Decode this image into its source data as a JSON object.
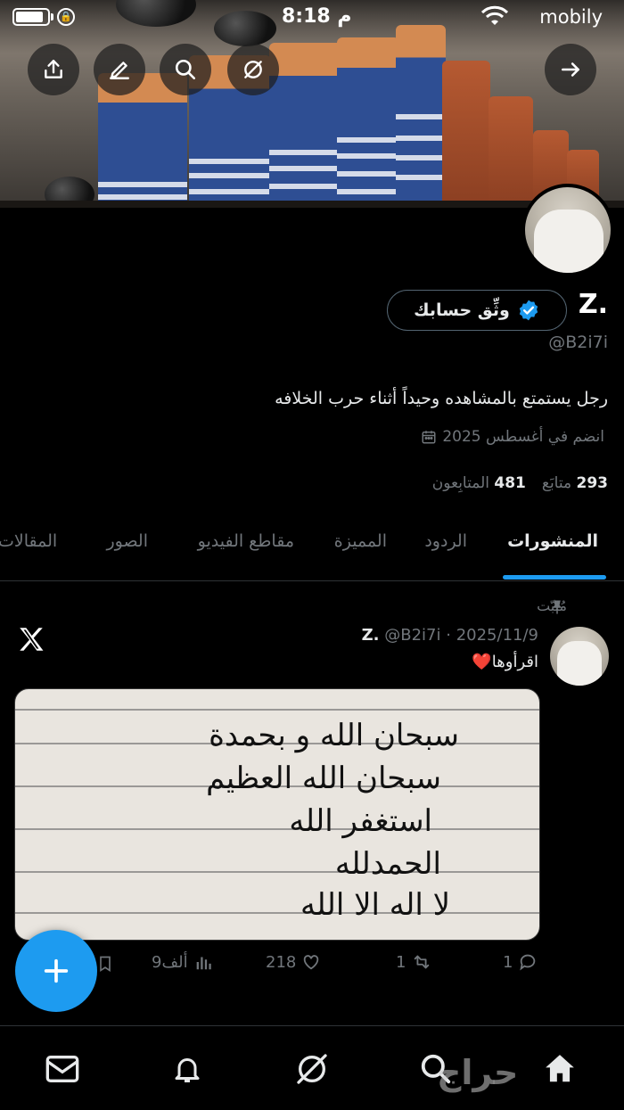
{
  "status_bar": {
    "time": "8:18 م",
    "carrier": "mobily"
  },
  "header": {
    "share_icon": "share-icon",
    "edit_icon": "pencil-icon",
    "search_icon": "search-icon",
    "grok_icon": "grok-icon",
    "forward_icon": "arrow-right-icon"
  },
  "profile": {
    "name": "Z.",
    "handle": "@B2i7i",
    "verify_button_label": "وثِّق حسابك",
    "bio": "رجل يستمتع بالمشاهده وحيداً أثناء حرب الخلافه",
    "joined": "انضم في أغسطس 2025",
    "following_count": "293",
    "following_label": "متابَع",
    "followers_count": "481",
    "followers_label": "المتابِعون"
  },
  "tabs": [
    {
      "label": "المنشورات",
      "active": true
    },
    {
      "label": "الردود",
      "active": false
    },
    {
      "label": "المميزة",
      "active": false
    },
    {
      "label": "مقاطع الفيديو",
      "active": false
    },
    {
      "label": "الصور",
      "active": false
    },
    {
      "label": "المقالات",
      "active": false
    }
  ],
  "post": {
    "pinned_label": "مُثبّت",
    "author_name": "Z.",
    "author_handle": "@B2i7i",
    "date": "2025/11/9",
    "separator": "·",
    "text": "اقرأوها❤️",
    "image_lines": [
      "سبحان الله و بحمدة",
      "سبحان الله العظيم",
      "استغفر الله",
      "الحمدلله",
      "لا اله الا الله"
    ],
    "replies": "1",
    "reposts": "1",
    "likes": "218",
    "views": "9ألف"
  },
  "fab": {
    "icon": "plus-icon"
  },
  "bottom_nav": [
    {
      "icon": "mail-icon"
    },
    {
      "icon": "bell-icon"
    },
    {
      "icon": "grok-icon"
    },
    {
      "icon": "search-icon"
    },
    {
      "icon": "home-icon"
    }
  ],
  "watermark": "حراج",
  "colors": {
    "accent": "#1d9bf0",
    "background": "#000000",
    "secondary_text": "#71767b"
  }
}
